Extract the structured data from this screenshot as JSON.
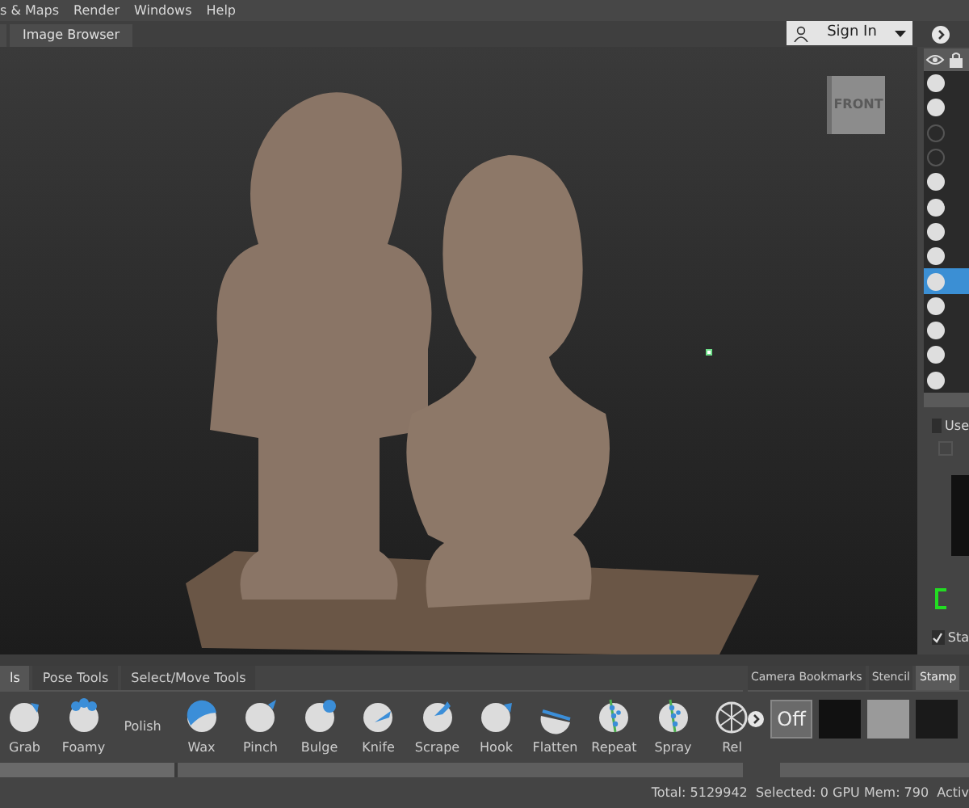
{
  "menu": [
    "s & Maps",
    "Render",
    "Windows",
    "Help"
  ],
  "tabs": [
    {
      "label": "Image Browser",
      "selected": true
    }
  ],
  "account": {
    "label": "Sign In"
  },
  "viewport": {
    "view_cube": "FRONT"
  },
  "layers": [
    {
      "visible": true,
      "selected": false
    },
    {
      "visible": true,
      "selected": false
    },
    {
      "visible": false,
      "selected": false
    },
    {
      "visible": false,
      "selected": false
    },
    {
      "visible": true,
      "selected": false
    },
    {
      "visible": true,
      "selected": false
    },
    {
      "visible": true,
      "selected": false
    },
    {
      "visible": true,
      "selected": false
    },
    {
      "visible": true,
      "selected": true
    },
    {
      "visible": true,
      "selected": false
    },
    {
      "visible": true,
      "selected": false
    },
    {
      "visible": true,
      "selected": false
    },
    {
      "visible": true,
      "selected": false
    }
  ],
  "layer_options": {
    "use": {
      "label": "Use",
      "checked": false
    },
    "stamp": {
      "label": "Sta",
      "checked": true
    }
  },
  "tool_tabs": [
    {
      "label": "ls",
      "selected": true
    },
    {
      "label": "Pose Tools",
      "selected": false
    },
    {
      "label": "Select/Move Tools",
      "selected": false
    }
  ],
  "tools": [
    {
      "label": "Grab",
      "kind": "grab"
    },
    {
      "label": "Foamy",
      "kind": "foamy"
    },
    {
      "label": "Polish",
      "kind": "none"
    },
    {
      "label": "Wax",
      "kind": "wax"
    },
    {
      "label": "Pinch",
      "kind": "pinch"
    },
    {
      "label": "Bulge",
      "kind": "bulge"
    },
    {
      "label": "Knife",
      "kind": "knife"
    },
    {
      "label": "Scrape",
      "kind": "scrape"
    },
    {
      "label": "Hook",
      "kind": "hook"
    },
    {
      "label": "Flatten",
      "kind": "flatten"
    },
    {
      "label": "Repeat",
      "kind": "repeat"
    },
    {
      "label": "Spray",
      "kind": "spray"
    },
    {
      "label": "Rel",
      "kind": "relax"
    }
  ],
  "tray_tabs": [
    {
      "label": "Camera Bookmarks",
      "selected": false
    },
    {
      "label": "Stencil",
      "selected": false
    },
    {
      "label": "Stamp",
      "selected": true
    }
  ],
  "stamp_off": "Off",
  "status": "Total: 5129942  Selected: 0 GPU Mem: 790  Activ"
}
